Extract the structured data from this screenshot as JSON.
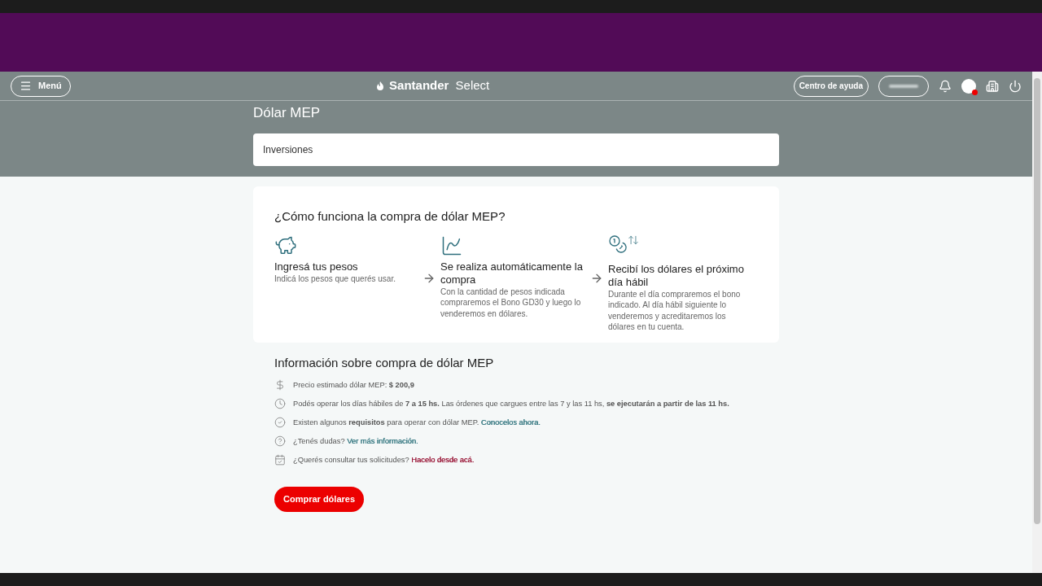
{
  "header": {
    "menu_label": "Menú",
    "brand": "Santander Select",
    "help_label": "Centro de ayuda",
    "notification_dot": true
  },
  "page": {
    "title": "Dólar MEP",
    "breadcrumb": "Inversiones"
  },
  "how_it_works": {
    "title": "¿Cómo funciona la compra de dólar MEP?",
    "steps": [
      {
        "kind": "piggy",
        "title": "Ingresá tus pesos",
        "description": "Indicá los pesos que querés usar."
      },
      {
        "kind": "chart",
        "title": "Se realiza automáticamente la compra",
        "description": "Con la cantidad de pesos indicada compraremos el Bono GD30 y luego lo venderemos en dólares."
      },
      {
        "kind": "coins",
        "title": "Recibí los dólares el próximo día hábil",
        "description": "Durante el día compraremos el bono indicado. Al día hábil siguiente lo venderemos y acreditaremos los dólares en tu cuenta."
      }
    ]
  },
  "info": {
    "title": "Información sobre compra de dólar MEP",
    "items": [
      {
        "kind": "dollar",
        "text": "Precio estimado dólar MEP: **$ 200,9**"
      },
      {
        "kind": "clock",
        "text": "Podés operar los días hábiles de **7 a 15 hs.** Las órdenes que cargues entre las 7 y las 11 hs, **se ejecutarán a partir de las 11 hs.**"
      },
      {
        "kind": "check",
        "text": "Existen algunos **requisitos** para operar con dólar MEP.",
        "link": "Conocelos ahora.",
        "color": "#3a7b84"
      },
      {
        "kind": "question",
        "text": "¿Tenés dudas?",
        "link": "Ver más información.",
        "color": "#3a7b84"
      },
      {
        "kind": "calendar",
        "text": "¿Querés consultar tus solicitudes?",
        "link": "Hacelo desde acá.",
        "color": "#9c1c3c"
      }
    ]
  },
  "action": {
    "label": "Comprar dólares"
  }
}
